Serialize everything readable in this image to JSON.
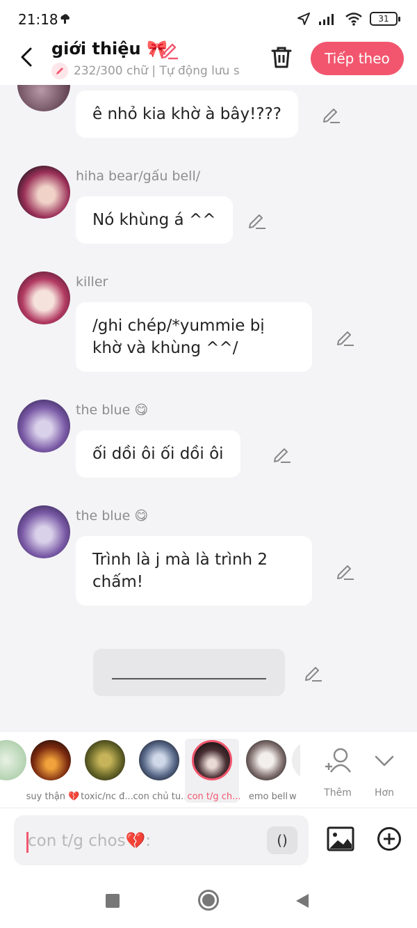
{
  "status": {
    "time": "21:18",
    "battery": "31"
  },
  "header": {
    "title": "giới thiệu 🎀",
    "subline": "232/300 chữ | Tự động lưu s",
    "next_label": "Tiếp theo"
  },
  "messages": [
    {
      "name": "",
      "text": "ê nhỏ kia khờ à bây!???"
    },
    {
      "name": "hiha bear/gấu bell/",
      "text": "Nó khùng á ^^"
    },
    {
      "name": "killer",
      "text": "/ghi chép/*yummie bị khờ và khùng ^^/"
    },
    {
      "name": "the blue 😋",
      "text": "ối dồi ôi  ối dồi ôi"
    },
    {
      "name": "the blue 😋",
      "text": "Trình là j mà là trình 2 chấm!"
    }
  ],
  "characters": [
    {
      "label": ""
    },
    {
      "label": "suy thận 💔"
    },
    {
      "label": "toxic/nc đ..."
    },
    {
      "label": "con chủ tu..."
    },
    {
      "label": "con t/g ch..."
    },
    {
      "label": "emo bell"
    },
    {
      "label": "w"
    }
  ],
  "tools": {
    "add_label": "Thêm",
    "more_label": "Hơn"
  },
  "input": {
    "placeholder": "con t/g chos💔:",
    "paren": "()"
  },
  "colors": {
    "accent": "#f2566e",
    "bubble": "#ffffff",
    "background": "#f4f4f6"
  }
}
